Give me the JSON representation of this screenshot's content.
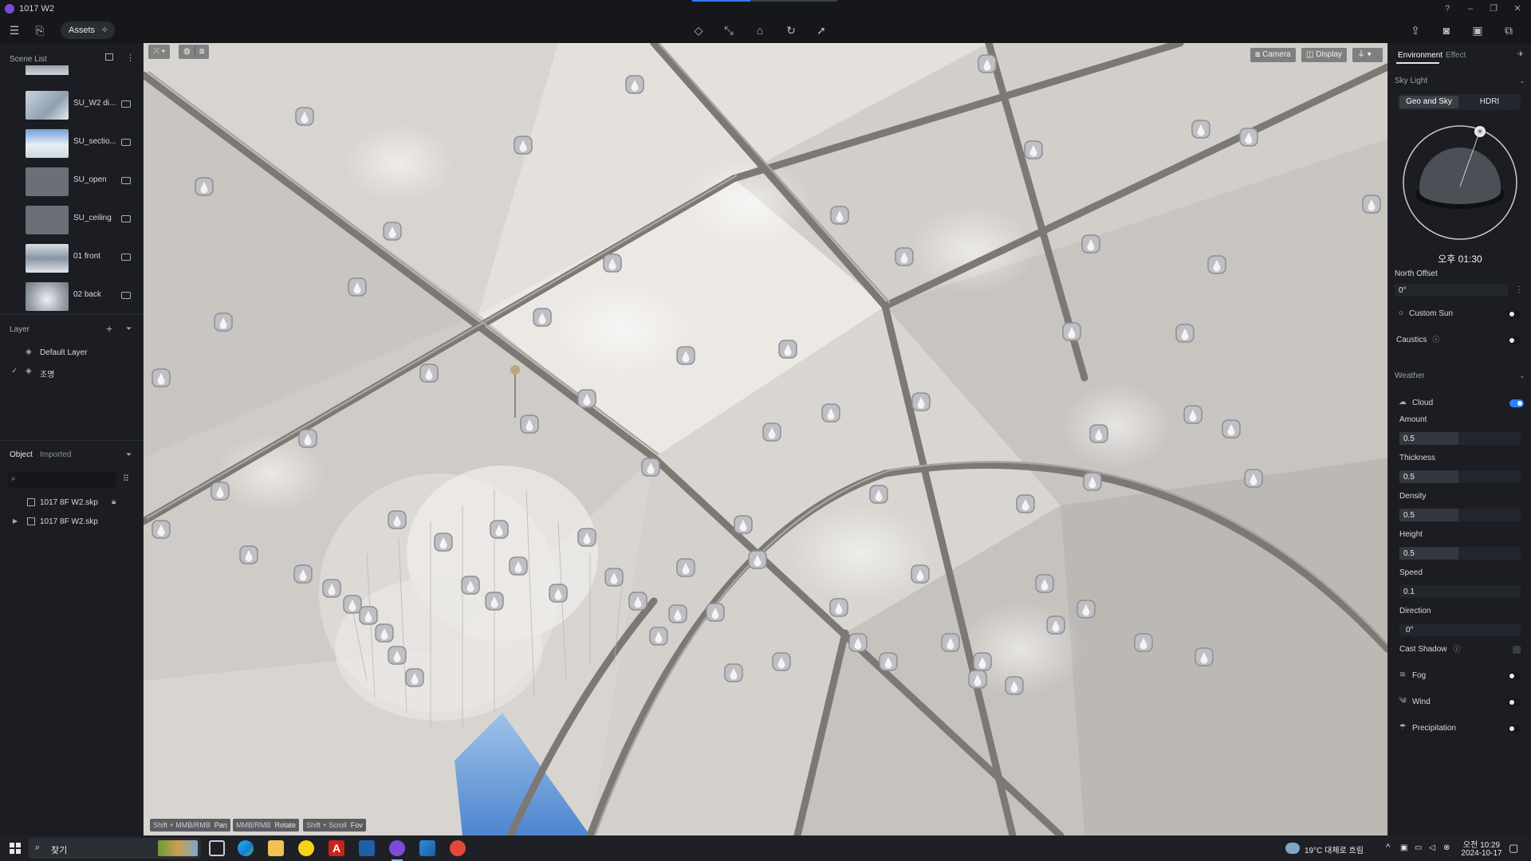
{
  "window": {
    "title": "1017 W2",
    "progress_fraction": 0.4
  },
  "toolbar": {
    "assets_label": "Assets"
  },
  "scene_list": {
    "header": "Scene List",
    "items": [
      {
        "label": "SU_W2 di..."
      },
      {
        "label": "SU_sectio..."
      },
      {
        "label": "SU_open"
      },
      {
        "label": "SU_ceiling"
      },
      {
        "label": "01 front"
      },
      {
        "label": "02 back"
      }
    ]
  },
  "layer": {
    "header": "Layer",
    "items": [
      {
        "label": "Default Layer"
      },
      {
        "label": "조명"
      }
    ]
  },
  "object": {
    "tab_object": "Object",
    "tab_imported": "Imported",
    "items": [
      {
        "label": "1017 8F W2.skp"
      },
      {
        "label": "1017 8F W2.skp"
      }
    ]
  },
  "viewport": {
    "camera_label": "Camera",
    "display_label": "Display",
    "hints": [
      {
        "keys": "Shift + MMB/RMB",
        "action": "Pan"
      },
      {
        "keys": "MMB/RMB",
        "action": "Rotate"
      },
      {
        "keys": "Shift + Scroll",
        "action": "Fov"
      }
    ]
  },
  "right_panel": {
    "tab_environment": "Environment",
    "tab_effect": "Effect",
    "sky_light": "Sky Light",
    "geo_and_sky": "Geo and Sky",
    "hdri": "HDRI",
    "time": "오후 01:30",
    "north_offset_label": "North Offset",
    "north_offset_value": "0°",
    "custom_sun": "Custom Sun",
    "caustics": "Caustics",
    "weather": "Weather",
    "cloud": "Cloud",
    "amount_label": "Amount",
    "amount_value": "0.5",
    "thickness_label": "Thickness",
    "thickness_value": "0.5",
    "density_label": "Density",
    "density_value": "0.5",
    "height_label": "Height",
    "height_value": "0.5",
    "speed_label": "Speed",
    "speed_value": "0.1",
    "direction_label": "Direction",
    "direction_value": "0°",
    "cast_shadow": "Cast Shadow",
    "fog": "Fog",
    "wind": "Wind",
    "precipitation": "Precipitation"
  },
  "taskbar": {
    "search_placeholder": "찾기",
    "weather": "19°C 대체로 흐림",
    "time": "오전 10:29",
    "date": "2024-10-17"
  }
}
